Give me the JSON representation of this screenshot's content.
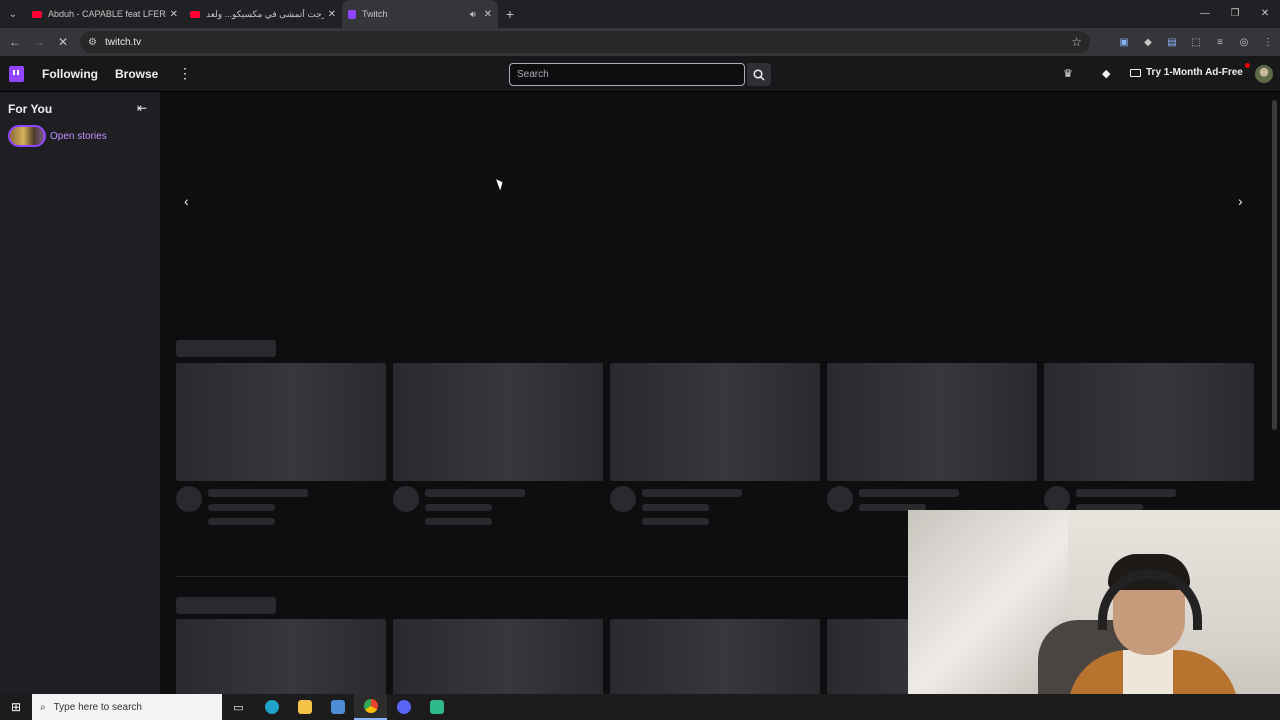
{
  "browser": {
    "tabs": [
      {
        "title": "Abduh - CAPABLE feat LFERDA",
        "favicon": "youtube-icon"
      },
      {
        "title": "خرجت أتمشى في مكسيكو... ولعد",
        "favicon": "youtube-icon"
      },
      {
        "title": "Twitch",
        "favicon": "twitch-icon",
        "active": true
      }
    ],
    "url": "twitch.tv"
  },
  "twitch": {
    "nav": {
      "following": "Following",
      "browse": "Browse",
      "search_placeholder": "Search",
      "ad_free": "Try 1-Month Ad-Free"
    },
    "sidebar": {
      "title": "For You",
      "stories_label": "Open stories"
    }
  },
  "taskbar": {
    "search_placeholder": "Type here to search"
  },
  "colors": {
    "brand": "#9146ff",
    "background": "#0e0e10",
    "sidebar": "#1f1f23"
  }
}
